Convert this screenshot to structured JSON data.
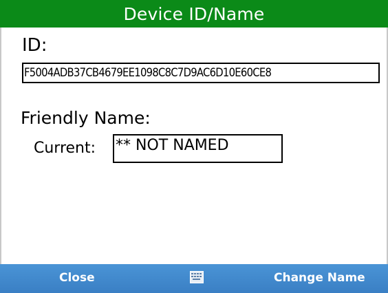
{
  "title_bar": {
    "title": "Device ID/Name"
  },
  "device_id": {
    "label": "ID:",
    "value": "F5004ADB37CB4679EE1098C8C7D9AC6D10E60CE8"
  },
  "friendly_name": {
    "label": "Friendly Name:",
    "current_label": "Current:",
    "current_value": "** NOT NAMED"
  },
  "softkeys": {
    "left_label": "Close",
    "center_icon": "keyboard-icon",
    "right_label": "Change Name"
  },
  "colors": {
    "title_bar_bg": "#0b8a18",
    "softkey_bar_bg": "#3f87cc",
    "text": "#000000"
  }
}
